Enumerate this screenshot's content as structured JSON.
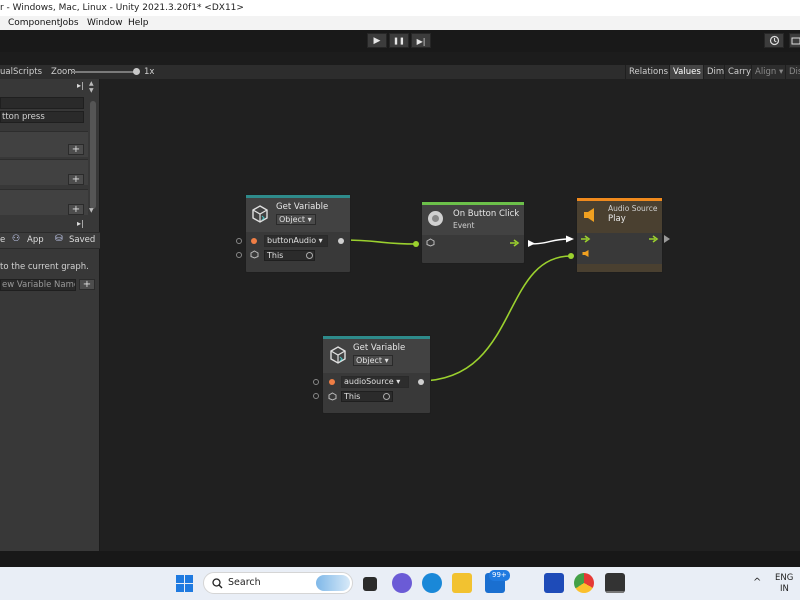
{
  "window": {
    "title": "r - Windows, Mac, Linux - Unity 2021.3.20f1* <DX11>"
  },
  "menu": {
    "items": [
      "Component",
      "Jobs",
      "Window",
      "Help"
    ]
  },
  "play_controls": {
    "play": "▶",
    "pause": "❚❚",
    "step": "▶|"
  },
  "graph_toolbar": {
    "breadcrumb": "ualScripts",
    "zoom_label": "Zoom",
    "zoom_value": "1x",
    "zoom_level": 1.0,
    "buttons": [
      "Relations",
      "Values",
      "Dim",
      "Carry",
      "Align ▾",
      "Dis"
    ],
    "active_button": "Values"
  },
  "side_panel": {
    "field_button_press": "tton press",
    "tabs": [
      "e",
      "App",
      "Saved"
    ],
    "hint_text": "to the current graph.",
    "new_variable_placeholder": "ew Variable Name)",
    "plus": "+"
  },
  "nodes": {
    "get_variable_1": {
      "title": "Get Variable",
      "kind": "Object",
      "variable": "buttonAudio",
      "scope": "This"
    },
    "on_button_click": {
      "title": "On Button Click",
      "subtitle": "Event"
    },
    "audio_source_play": {
      "title": "Audio Source",
      "subtitle": "Play"
    },
    "get_variable_2": {
      "title": "Get Variable",
      "kind": "Object",
      "variable": "audioSource",
      "scope": "This"
    }
  },
  "colors": {
    "accent_teal": "#2e8b8b",
    "event_green": "#6cc04a",
    "audio_orange": "#f08a1d",
    "wire_green": "#9bd12e",
    "value_port_orange": "#f07e45"
  },
  "taskbar": {
    "search_placeholder": "Search",
    "badge": "99+",
    "lang": "ENG",
    "region": "IN",
    "chevron": "^"
  }
}
